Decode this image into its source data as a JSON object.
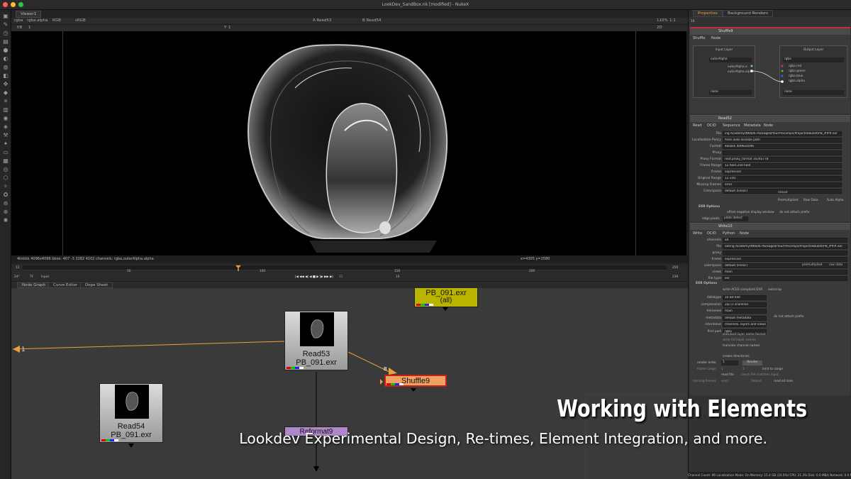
{
  "window": {
    "title": "LookDev_SandBox.nk [modified] - NukeX"
  },
  "viewer": {
    "tab": "Viewer1",
    "channels": "rgba",
    "layer": "rgba.alpha",
    "display": "RGB",
    "colorspace": "sRGB",
    "input_a": "A  Read53",
    "input_b": "B  Read54",
    "zoom": "110%",
    "ratio": "1:1",
    "frame_field": "1",
    "gain": "f/8",
    "gain_val": "1",
    "y_field": "Y",
    "gamma_val": "1",
    "proxy_field": "2D",
    "format_info": "4kkkkk 4096x4096  bbox: 407 -3 3282 4102 channels: rgba,outerAlpha.alpha",
    "coords": "x=4305 y=2580"
  },
  "timeline": {
    "start": "12",
    "end": "250",
    "fps": "24*",
    "tf": "TF",
    "mode": "Input",
    "ticks": [
      "12",
      "50",
      "100",
      "150",
      "200",
      "250"
    ],
    "current": "31",
    "step": "10",
    "out": "239"
  },
  "nodegraph": {
    "tabs": [
      "Node Graph",
      "Curve Editor",
      "Dope Sheet"
    ],
    "nodes": {
      "pb_all": {
        "line1": "PB_091.exr",
        "line2": "(all)"
      },
      "read53": {
        "line1": "Read53",
        "line2": "PB_091.exr"
      },
      "read54": {
        "line1": "Read54",
        "line2": "PB_091.exr"
      },
      "shuffle9": {
        "label": "Shuffle9"
      },
      "reformat9": {
        "label": "Reformat9"
      }
    },
    "pipe_label": "1",
    "input_b": "B"
  },
  "properties": {
    "tabs": [
      "Properties",
      "Background Renders"
    ],
    "count": "10",
    "shuffle": {
      "name": "Shuffle9",
      "tabs": [
        "Shuffle",
        "Node"
      ],
      "input_layer": "Input Layer",
      "output_layer": "Output Layer",
      "in1": "outerAlpha",
      "in_channels": [
        "outerAlpha.a",
        "outerAlpha.alpha"
      ],
      "out1": "rgba",
      "out_channels": [
        "rgba.red",
        "rgba.green",
        "rgba.blue",
        "rgba.alpha"
      ],
      "in2": "none",
      "out2": "none"
    },
    "read": {
      "name": "Read52",
      "tabs": [
        "Read",
        "OCIO",
        "Sequence",
        "Metadata",
        "Node"
      ],
      "rows": [
        {
          "label": "File",
          "value": "ing Academy/NK606 Packaged/YourPrecomps/ProjectileBullet/PB_###.exr"
        },
        {
          "label": "Localization Policy",
          "value": "from auto-localize path"
        },
        {
          "label": "Format",
          "value": "4kkkkk 4096x4096"
        },
        {
          "label": "Proxy",
          "value": ""
        },
        {
          "label": "Proxy Format",
          "value": "root.proxy_format 1024x778"
        },
        {
          "label": "Frame Range",
          "value": "12       hold      250      hold"
        },
        {
          "label": "Frame",
          "value": "expression"
        },
        {
          "label": "Original Range",
          "value": "12       250"
        },
        {
          "label": "Missing Frames",
          "value": "error"
        },
        {
          "label": "Colorspace",
          "value": "default (linear)"
        }
      ],
      "reload": "reload",
      "color_opts": [
        "Premultiplied",
        "Raw Data",
        "Auto Alpha"
      ],
      "exr_options": "EXR Options",
      "exr_opts": [
        "offset negative display window",
        "do not attach prefix"
      ],
      "edge_label": "edge pixels",
      "edge_value": "plate detect"
    },
    "write": {
      "name": "Write10",
      "tabs": [
        "Write",
        "OCIO",
        "Python",
        "Node"
      ],
      "rows": [
        {
          "label": "channels",
          "value": "all"
        },
        {
          "label": "file",
          "value": "ooting Academy/NK606 Packaged/YourPrecomps/ProjectileBullet/PB_###.exr"
        },
        {
          "label": "proxy",
          "value": ""
        },
        {
          "label": "frame",
          "value": "expression"
        },
        {
          "label": "colorspace",
          "value": "default (linear)"
        },
        {
          "label": "views",
          "value": "main"
        },
        {
          "label": "file type",
          "value": "exr"
        }
      ],
      "color_opts": [
        "premultiplied",
        "raw data"
      ],
      "exr_options": "EXR Options",
      "exr_row": [
        "write ACES compliant EXR",
        "autocrop"
      ],
      "rows2": [
        {
          "label": "datatype",
          "value": "16 bit half"
        },
        {
          "label": "compression",
          "value": "Zip (1 scanline)"
        },
        {
          "label": "heroview",
          "value": "main"
        },
        {
          "label": "metadata",
          "value": "default metadata"
        },
        {
          "label": "interleave",
          "value": "channels, layers and views"
        },
        {
          "label": "first part",
          "value": "rgba"
        }
      ],
      "no_attach": "do not attach prefix",
      "checks": [
        "standard layer name format",
        "write full layer names",
        "truncate channel names",
        "create directories"
      ],
      "render_order_label": "render order",
      "render_order": "1",
      "render_button": "Render",
      "frame_range_label": "frame range",
      "frame_range": [
        "1",
        "1"
      ],
      "limit": "limit to range",
      "read_file": "read file",
      "check_file": "check file matches input",
      "missing_label": "missing frames",
      "missing_value": "error",
      "reload": "Reload",
      "read_all": "read all lines"
    }
  },
  "statusbar": {
    "text": "Channel Count: 86  Localization Mode: On  Memory: 15.4 GB (24.0%)  CPU: 21.3%  Disk: 0.0 MB/s  Network: 0.0 MB/s"
  },
  "caption": {
    "title": "Working with Elements",
    "subtitle": "Lookdev Experimental Design, Re-times, Element Integration, and more."
  },
  "colors": {
    "read_node": "#cfcfcf",
    "shuffle_node": "#f0a060",
    "reformat_node": "#b088c8",
    "pb_node": "#b8b400",
    "pipe_orange": "#e8a040"
  }
}
